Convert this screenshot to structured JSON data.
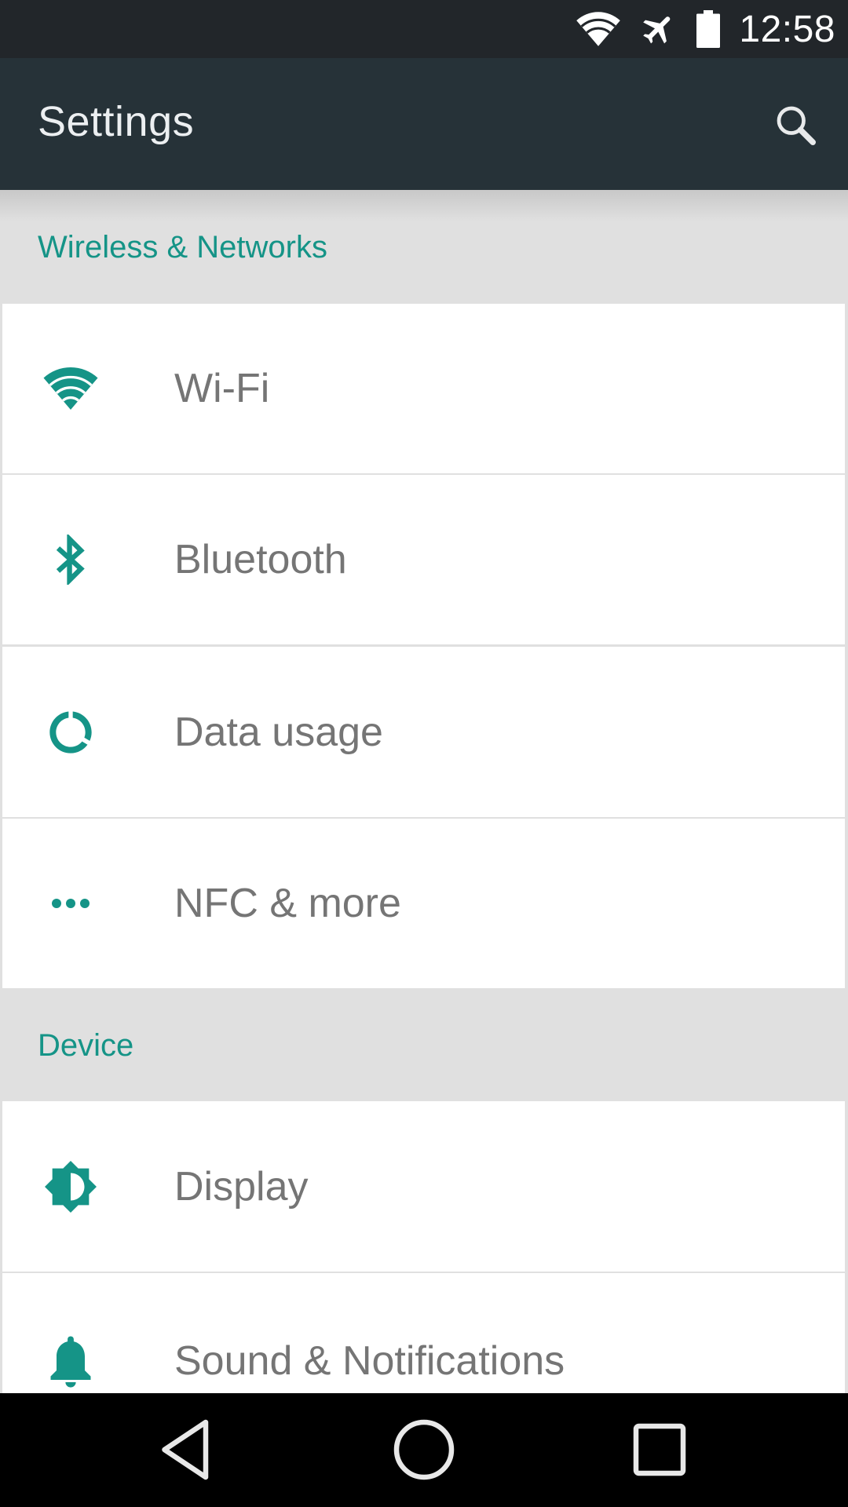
{
  "status_bar": {
    "time": "12:58",
    "icons": [
      "wifi-icon",
      "airplane-mode-icon",
      "battery-icon"
    ]
  },
  "app_bar": {
    "title": "Settings",
    "search_icon": "search-icon"
  },
  "sections": [
    {
      "title": "Wireless & Networks",
      "items": [
        {
          "label": "Wi-Fi",
          "icon": "wifi-icon"
        },
        {
          "label": "Bluetooth",
          "icon": "bluetooth-icon"
        },
        {
          "label": "Data usage",
          "icon": "data-usage-icon"
        },
        {
          "label": "NFC & more",
          "icon": "more-dots-icon"
        }
      ]
    },
    {
      "title": "Device",
      "items": [
        {
          "label": "Display",
          "icon": "brightness-icon"
        },
        {
          "label": "Sound & Notifications",
          "icon": "bell-icon"
        }
      ]
    }
  ],
  "nav_bar": {
    "buttons": [
      "back",
      "home",
      "recents"
    ]
  },
  "colors": {
    "accent": "#159487",
    "app_bar": "#263238",
    "status_bar": "#22262a",
    "item_text": "#757575",
    "section_bg": "#e0e0e0"
  }
}
